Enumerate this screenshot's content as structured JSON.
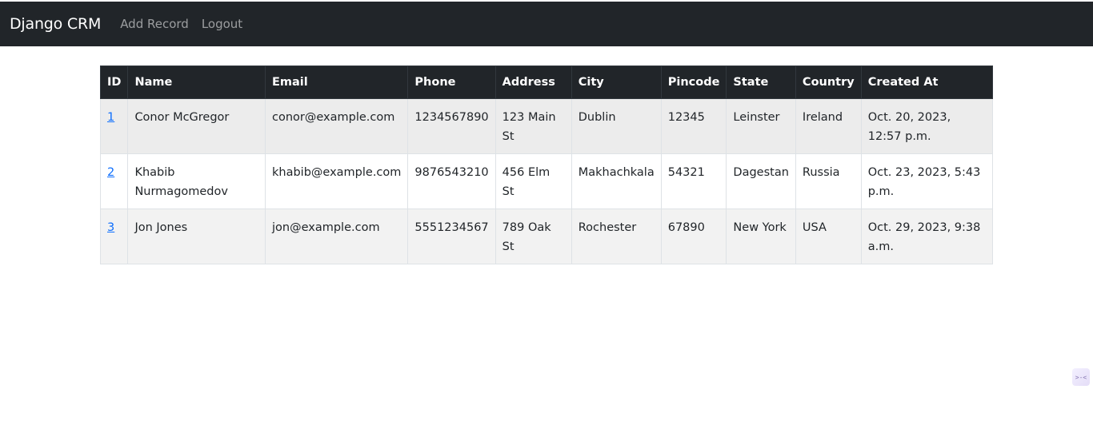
{
  "navbar": {
    "brand": "Django CRM",
    "links": [
      "Add Record",
      "Logout"
    ]
  },
  "table": {
    "headers": [
      "ID",
      "Name",
      "Email",
      "Phone",
      "Address",
      "City",
      "Pincode",
      "State",
      "Country",
      "Created At"
    ],
    "rows": [
      {
        "id": "1",
        "name": "Conor McGregor",
        "email": "conor@example.com",
        "phone": "1234567890",
        "address": "123 Main St",
        "city": "Dublin",
        "pincode": "12345",
        "state": "Leinster",
        "country": "Ireland",
        "created_at": "Oct. 20, 2023, 12:57 p.m."
      },
      {
        "id": "2",
        "name": "Khabib Nurmagomedov",
        "email": "khabib@example.com",
        "phone": "9876543210",
        "address": "456 Elm St",
        "city": "Makhachkala",
        "pincode": "54321",
        "state": "Dagestan",
        "country": "Russia",
        "created_at": "Oct. 23, 2023, 5:43 p.m."
      },
      {
        "id": "3",
        "name": "Jon Jones",
        "email": "jon@example.com",
        "phone": "5551234567",
        "address": "789 Oak St",
        "city": "Rochester",
        "pincode": "67890",
        "state": "New York",
        "country": "USA",
        "created_at": "Oct. 29, 2023, 9:38 a.m."
      }
    ]
  },
  "corner_widget": {
    "icon": "extension-toggle-icon",
    "glyph": ">-<"
  }
}
